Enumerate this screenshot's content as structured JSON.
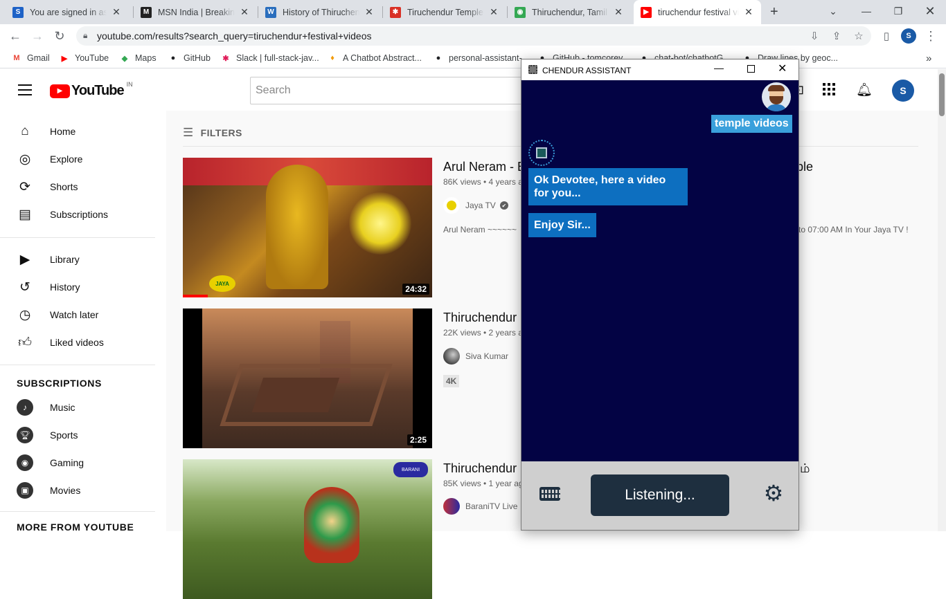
{
  "browser": {
    "tabs": [
      {
        "title": "You are signed in as c",
        "favicon": "S",
        "favicon_color": "#1e62c7",
        "active": false
      },
      {
        "title": "MSN India | Breaking N",
        "favicon": "M",
        "favicon_color": "#222222",
        "active": false
      },
      {
        "title": "History of Thiruchend",
        "favicon": "W",
        "favicon_color": "#2a6ebd",
        "active": false
      },
      {
        "title": "Tiruchendur Temple N",
        "favicon": "✱",
        "favicon_color": "#d93025",
        "active": false
      },
      {
        "title": "Thiruchendur, Tamil N",
        "favicon": "◉",
        "favicon_color": "#34a853",
        "active": false
      },
      {
        "title": "tiruchendur festival vic",
        "favicon": "▶",
        "favicon_color": "#ff0000",
        "active": true
      }
    ],
    "new_tab": "+",
    "url": "youtube.com/results?search_query=tiruchendur+festival+videos",
    "profile_initial": "S",
    "bookmarks": [
      {
        "label": "Gmail",
        "icon": "M"
      },
      {
        "label": "YouTube",
        "icon": "▶"
      },
      {
        "label": "Maps",
        "icon": "◆"
      },
      {
        "label": "GitHub",
        "icon": "●"
      },
      {
        "label": "Slack | full-stack-jav...",
        "icon": "✱"
      },
      {
        "label": "A Chatbot Abstract...",
        "icon": "♦"
      },
      {
        "label": "personal-assistant-...",
        "icon": "●"
      },
      {
        "label": "GitHub - tomcorey...",
        "icon": "●"
      },
      {
        "label": "chat-bot/chatbotG...",
        "icon": "●"
      },
      {
        "label": "Draw lines by geoc...",
        "icon": "●"
      }
    ],
    "bookmarks_more": "»"
  },
  "youtube": {
    "logo_text": "YouTube",
    "country": "IN",
    "search_placeholder": "Search",
    "avatar_initial": "S",
    "sidebar": {
      "primary": [
        {
          "label": "Home",
          "icon": "home-icon"
        },
        {
          "label": "Explore",
          "icon": "compass-icon"
        },
        {
          "label": "Shorts",
          "icon": "shorts-icon"
        },
        {
          "label": "Subscriptions",
          "icon": "subscriptions-icon"
        }
      ],
      "secondary": [
        {
          "label": "Library",
          "icon": "library-icon"
        },
        {
          "label": "History",
          "icon": "history-icon"
        },
        {
          "label": "Watch later",
          "icon": "clock-icon"
        },
        {
          "label": "Liked videos",
          "icon": "thumbs-up-icon"
        }
      ],
      "subscriptions_heading": "SUBSCRIPTIONS",
      "subscriptions": [
        {
          "label": "Music"
        },
        {
          "label": "Sports"
        },
        {
          "label": "Gaming"
        },
        {
          "label": "Movies"
        }
      ],
      "more_heading": "MORE FROM YOUTUBE"
    },
    "filters_label": "FILTERS",
    "videos": [
      {
        "title": "Arul Neram - E",
        "title_tail": "mple",
        "meta": "86K views • 4 years a",
        "channel": "Jaya TV",
        "verified": "✔",
        "desc": "Arul Neram ~~~~~~",
        "desc_tail": "to 07:00 AM In Your Jaya TV !",
        "duration": "24:32",
        "badge": "",
        "watched": 0.1
      },
      {
        "title": "Thiruchendur",
        "title_tail": "",
        "meta": "22K views • 2 years a",
        "channel": "Siva Kumar",
        "verified": "",
        "desc": "",
        "desc_tail": "",
        "duration": "2:25",
        "badge": "4K",
        "watched": 0
      },
      {
        "title": "Thiruchendur",
        "title_tail": "ம்",
        "meta": "85K views • 1 year ag",
        "channel": "BaraniTV Live",
        "verified": "",
        "desc": "",
        "desc_tail": "",
        "duration": "",
        "badge": "",
        "watched": 0
      }
    ]
  },
  "assistant": {
    "title": "CHENDUR ASSISTANT",
    "user_message": "temple videos",
    "bot_messages": [
      "Ok Devotee, here a video for you...",
      "Enjoy Sir..."
    ],
    "listening_label": "Listening..."
  }
}
